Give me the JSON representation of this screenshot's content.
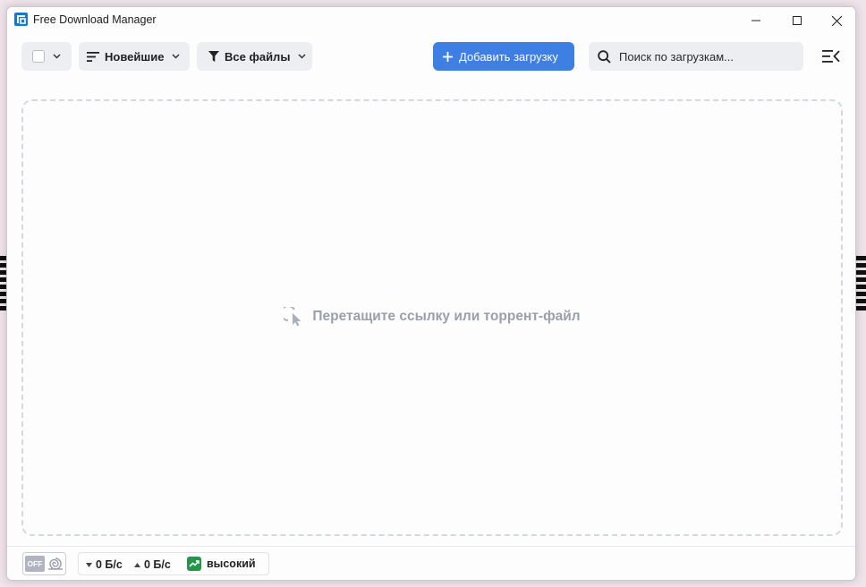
{
  "titlebar": {
    "app_title": "Free Download Manager",
    "logo_color": "#1c78c0"
  },
  "toolbar": {
    "select_all_icon": "checkbox-icon",
    "sort_label": "Новейшие",
    "filter_label": "Все файлы",
    "add_download_label": "Добавить загрузку",
    "search_placeholder": "Поиск по загрузкам...",
    "accent_color": "#3d7fe2"
  },
  "main": {
    "drop_hint": "Перетащите ссылку или торрент-файл"
  },
  "statusbar": {
    "snail_mode_label": "OFF",
    "download_speed": "0 Б/с",
    "upload_speed": "0 Б/с",
    "priority_label": "высокий",
    "priority_color": "#26944a"
  }
}
